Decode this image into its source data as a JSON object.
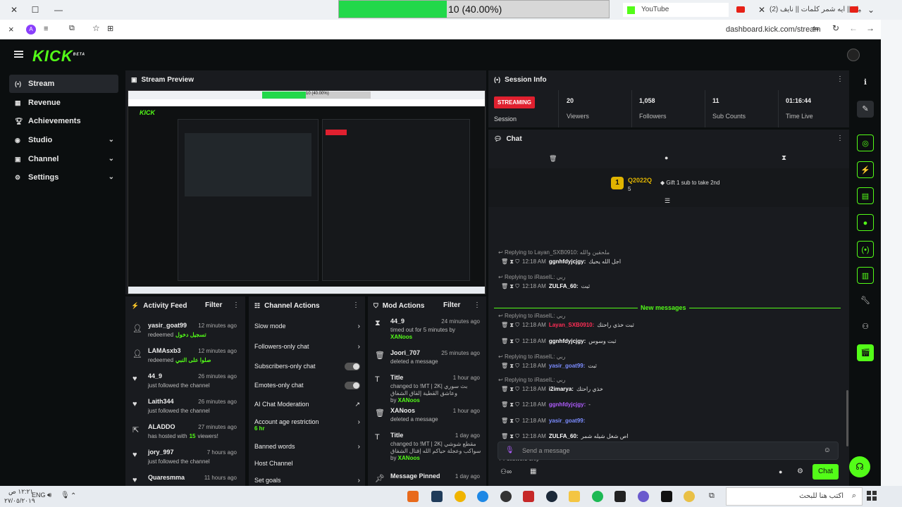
{
  "browser": {
    "progress_text": "10 (40.00%)",
    "progress_value": 0.4,
    "tabs": [
      {
        "label": "YouTube"
      },
      {
        "label": "(2) شيلة || ايه شمر كلمات || نايف"
      }
    ],
    "url": "dashboard.kick.com/stream",
    "avatar_letter": "A"
  },
  "app": {
    "logo": "KICK",
    "logo_sup": "BETA",
    "nav": [
      {
        "label": "Stream",
        "icon": "stream-icon"
      },
      {
        "label": "Revenue",
        "icon": "revenue-icon"
      },
      {
        "label": "Achievements",
        "icon": "trophy-icon"
      },
      {
        "label": "Studio",
        "icon": "studio-icon"
      },
      {
        "label": "Channel",
        "icon": "channel-icon"
      },
      {
        "label": "Settings",
        "icon": "gear-icon"
      }
    ]
  },
  "stream_preview": {
    "title": "Stream Preview",
    "inner_progress": "10 (40.00%)"
  },
  "session": {
    "title": "Session Info",
    "status": "STREAMING",
    "status_label": "Session",
    "stats": [
      {
        "value": "20",
        "label": "Viewers"
      },
      {
        "value": "1,058",
        "label": "Followers"
      },
      {
        "value": "11",
        "label": "Sub Counts"
      },
      {
        "value": "01:16:44",
        "label": "Time Live"
      }
    ]
  },
  "chat": {
    "title": "Chat",
    "top_gifter": {
      "rank": "1",
      "name": "Q2022Q",
      "count": "5"
    },
    "gift_prompt": "Gift 1 sub to take 2nd",
    "new_messages": "New messages",
    "lines": [
      {
        "reply": "Replying to Layan_SXB0910: ملحقين والله",
        "time": "12:18 AM",
        "user": "ggnhfdyjcjgy:",
        "msg": "اجل الله يحيك",
        "color": "#ffffff"
      },
      {
        "reply": "Replying to iRaseIL: ربي",
        "time": "12:18 AM",
        "user": "ZULFA_60:",
        "msg": "ثبت",
        "color": "#ffffff"
      },
      {
        "reply": "Replying to iRaseIL: ربي",
        "time": "12:18 AM",
        "user": "Layan_SXB0910:",
        "msg": "ثبت خذي راحتك",
        "color": "#ff2d55"
      },
      {
        "reply": "",
        "time": "12:18 AM",
        "user": "ggnhfdyjcjgy:",
        "msg": "ثبت وسوس",
        "color": "#ffffff"
      },
      {
        "reply": "Replying to iRaseIL: ربي",
        "time": "12:18 AM",
        "user": "yasir_goat99:",
        "msg": "ثبت",
        "color": "#7b8cff"
      },
      {
        "reply": "Replying to iRaseIL: ربي",
        "time": "12:18 AM",
        "user": "i2imarya:",
        "msg": "خذي راحتك",
        "color": "#ffffff"
      },
      {
        "reply": "",
        "time": "12:18 AM",
        "user": "ggnhfdyjcjgy:",
        "msg": "-",
        "color": "#b05cff"
      },
      {
        "reply": "",
        "time": "12:18 AM",
        "user": "yasir_goat99:",
        "msg": "",
        "color": "#7b8cff"
      },
      {
        "reply": "",
        "time": "12:18 AM",
        "user": "ZULFA_60:",
        "msg": "اص شغل شيله شمر",
        "color": "#ffffff"
      }
    ],
    "followers_only": "Followers only",
    "placeholder": "Send a message",
    "send_label": "Chat"
  },
  "activity": {
    "title": "Activity Feed",
    "filter": "Filter",
    "items": [
      {
        "user": "yasir_goat99",
        "time": "12 minutes ago",
        "text": "redeemed",
        "extra": "تسجيل دخول",
        "icon": "person-icon"
      },
      {
        "user": "LAMAsxb3",
        "time": "12 minutes ago",
        "text": "redeemed",
        "extra": "صلوا على النبي",
        "icon": "person-icon"
      },
      {
        "user": "44_9",
        "time": "26 minutes ago",
        "text": "just followed the channel",
        "extra": "",
        "icon": "heart-icon"
      },
      {
        "user": "Laith344",
        "time": "26 minutes ago",
        "text": "just followed the channel",
        "extra": "",
        "icon": "heart-icon"
      },
      {
        "user": "ALADDO",
        "time": "27 minutes ago",
        "text": "has hosted with",
        "extra": "15",
        "extra2": "viewers!",
        "icon": "host-icon"
      },
      {
        "user": "jory_997",
        "time": "7 hours ago",
        "text": "just followed the channel",
        "extra": "",
        "icon": "heart-icon"
      },
      {
        "user": "Quaresmma",
        "time": "11 hours ago",
        "text": "",
        "extra": "",
        "icon": "heart-icon"
      }
    ]
  },
  "channel_actions": {
    "title": "Channel Actions",
    "items": [
      {
        "label": "Slow mode",
        "control": "arrow"
      },
      {
        "label": "Followers-only chat",
        "control": "arrow"
      },
      {
        "label": "Subscribers-only chat",
        "control": "toggle"
      },
      {
        "label": "Emotes-only chat",
        "control": "toggle"
      },
      {
        "label": "AI Chat Moderation",
        "control": "link"
      },
      {
        "label": "Account age restriction",
        "sub": "6 hr",
        "control": "arrow"
      },
      {
        "label": "Banned words",
        "control": "arrow"
      },
      {
        "label": "Host Channel",
        "control": "none"
      },
      {
        "label": "Set goals",
        "control": "arrow"
      }
    ]
  },
  "mod_actions": {
    "title": "Mod Actions",
    "filter": "Filter",
    "items": [
      {
        "user": "44_9",
        "time": "24 minutes ago",
        "line1": "timed out for 5 minutes by",
        "by": "XANoos",
        "icon": "hourglass-icon"
      },
      {
        "user": "Joori_707",
        "time": "25 minutes ago",
        "line1": "deleted a message",
        "by": "",
        "icon": "trash-icon"
      },
      {
        "user": "Title",
        "time": "1 hour ago",
        "line1": "changed to !MT | 2K| بث سوري",
        "line2": "وعاشق القطية إلقاق الشفاق",
        "by": "XANoos",
        "icon": "text-icon"
      },
      {
        "user": "XANoos",
        "time": "1 hour ago",
        "line1": "deleted a message",
        "by": "",
        "icon": "trash-icon"
      },
      {
        "user": "Title",
        "time": "1 day ago",
        "line1": "changed to !MT | 2K| مقطع شوشي",
        "line2": "اوناتي سواكب وعجلة حياكم الله إقتال الشفاق",
        "by": "XANoos",
        "icon": "text-icon"
      },
      {
        "user": "Message Pinned",
        "time": "1 day ago",
        "line1": "",
        "by": "",
        "icon": "pin-icon"
      }
    ]
  },
  "taskbar": {
    "search_placeholder": "اكتب هنا للبحث",
    "lang": "ENG",
    "time": "١٢:٢١ ص",
    "date": "٢٧/٠٥/٢٠١٩"
  },
  "colors": {
    "accent": "#53fc18",
    "bg": "#0b0e0f",
    "panel": "#191b1f",
    "streaming": "#e0202f"
  }
}
